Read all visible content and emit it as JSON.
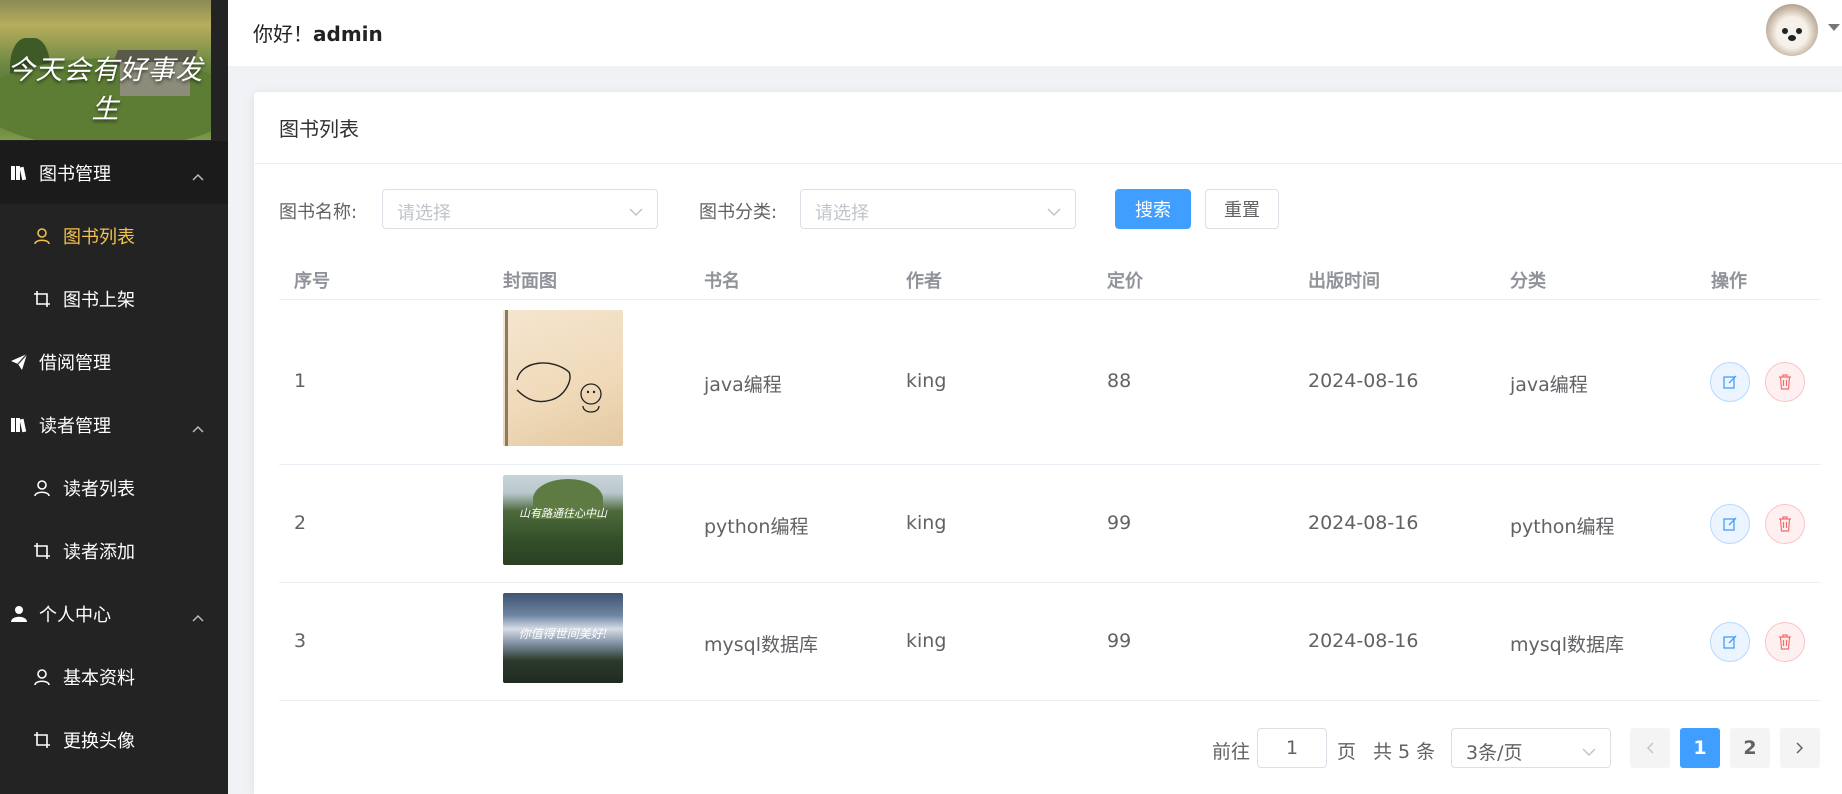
{
  "sidebar": {
    "logo_text": "今天会有好事发生",
    "menu": [
      {
        "label": "图书管理",
        "icon": "book-icon",
        "expanded": true
      },
      {
        "label": "图书列表",
        "icon": "user-icon",
        "active": true
      },
      {
        "label": "图书上架",
        "icon": "crop-icon"
      },
      {
        "label": "借阅管理",
        "icon": "paper-plane-icon"
      },
      {
        "label": "读者管理",
        "icon": "book-icon",
        "expanded": true
      },
      {
        "label": "读者列表",
        "icon": "user-icon"
      },
      {
        "label": "读者添加",
        "icon": "crop-icon"
      },
      {
        "label": "个人中心",
        "icon": "user-solid-icon",
        "expanded": true
      },
      {
        "label": "基本资料",
        "icon": "user-icon"
      },
      {
        "label": "更换头像",
        "icon": "crop-icon"
      }
    ]
  },
  "header": {
    "greeting": "你好！",
    "username": "admin"
  },
  "card": {
    "title": "图书列表"
  },
  "filter": {
    "name_label": "图书名称:",
    "name_placeholder": "请选择",
    "category_label": "图书分类:",
    "category_placeholder": "请选择",
    "search_label": "搜索",
    "reset_label": "重置"
  },
  "table": {
    "columns": [
      "序号",
      "封面图",
      "书名",
      "作者",
      "定价",
      "出版时间",
      "分类",
      "操作"
    ],
    "rows": [
      {
        "index": "1",
        "title": "java编程",
        "author": "king",
        "price": "88",
        "date": "2024-08-16",
        "category": "java编程",
        "cover_text": ""
      },
      {
        "index": "2",
        "title": "python编程",
        "author": "king",
        "price": "99",
        "date": "2024-08-16",
        "category": "python编程",
        "cover_text": "山有路通往心中山"
      },
      {
        "index": "3",
        "title": "mysql数据库",
        "author": "king",
        "price": "99",
        "date": "2024-08-16",
        "category": "mysql数据库",
        "cover_text": "你值得世间美好!"
      }
    ]
  },
  "pagination": {
    "goto_label": "前往",
    "goto_value": "1",
    "page_unit": "页",
    "total_text": "共 5 条",
    "page_size": "3条/页",
    "pages": [
      "1",
      "2"
    ],
    "current_page": "1"
  },
  "colors": {
    "primary": "#409eff",
    "sidebar_bg": "#232323",
    "active_menu": "#f3c24d",
    "danger": "#f56c6c"
  }
}
